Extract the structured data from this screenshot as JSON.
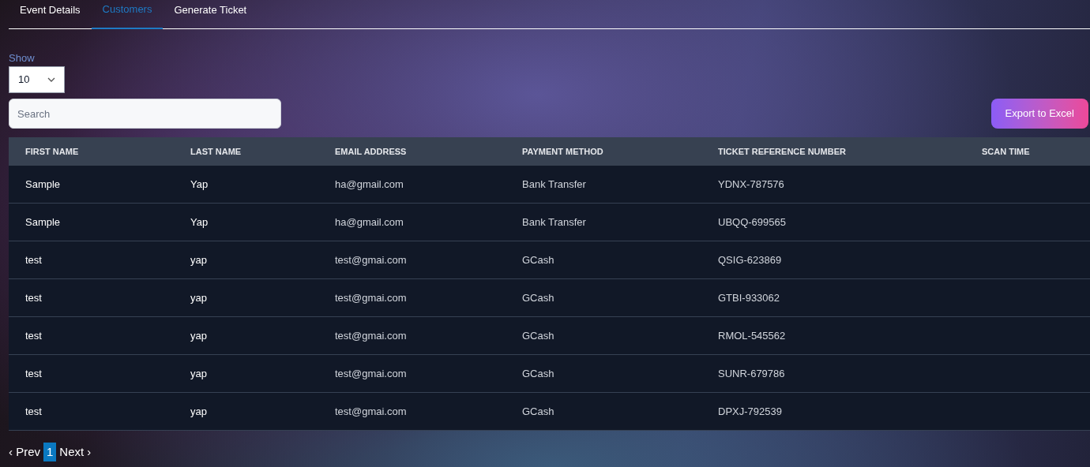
{
  "tabs": [
    {
      "label": "Event Details",
      "selected": false
    },
    {
      "label": "Customers",
      "selected": true
    },
    {
      "label": "Generate Ticket",
      "selected": false
    }
  ],
  "show_label": "Show",
  "page_size": {
    "value": "10"
  },
  "search": {
    "placeholder": "Search"
  },
  "export_button": "Export to Excel",
  "table": {
    "columns": [
      "FIRST NAME",
      "LAST NAME",
      "EMAIL ADDRESS",
      "PAYMENT METHOD",
      "TICKET REFERENCE NUMBER",
      "SCAN TIME"
    ],
    "rows": [
      [
        "Sample",
        "Yap",
        "ha@gmail.com",
        "Bank Transfer",
        "YDNX-787576"
      ],
      [
        "Sample",
        "Yap",
        "ha@gmail.com",
        "Bank Transfer",
        "UBQQ-699565"
      ],
      [
        "test",
        "yap",
        "test@gmai.com",
        "GCash",
        "QSIG-623869"
      ],
      [
        "test",
        "yap",
        "test@gmai.com",
        "GCash",
        "GTBI-933062"
      ],
      [
        "test",
        "yap",
        "test@gmai.com",
        "GCash",
        "RMOL-545562"
      ],
      [
        "test",
        "yap",
        "test@gmai.com",
        "GCash",
        "SUNR-679786"
      ],
      [
        "test",
        "yap",
        "test@gmai.com",
        "GCash",
        "DPXJ-792539"
      ]
    ]
  },
  "pagination": {
    "prev": "‹ Prev",
    "next": "Next ›",
    "pages": [
      {
        "label": "1",
        "selected": true
      }
    ]
  }
}
